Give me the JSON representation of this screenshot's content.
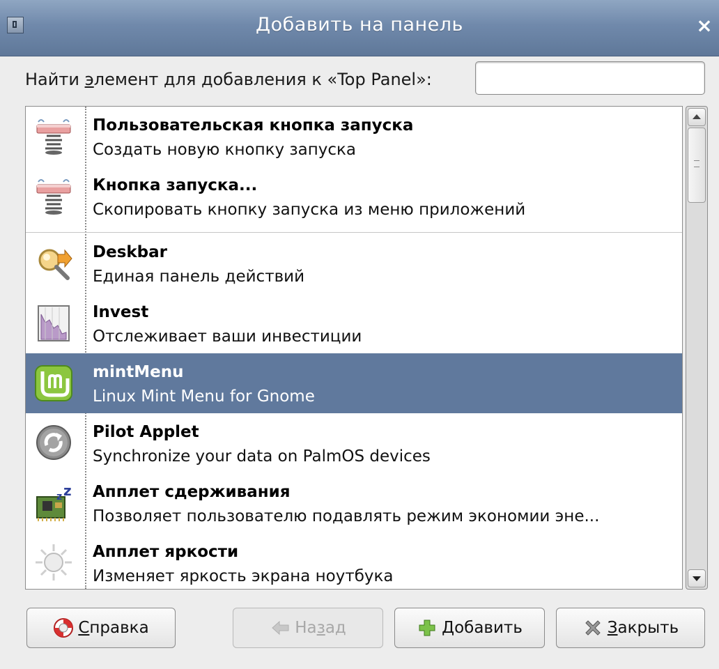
{
  "window": {
    "title": "Добавить на панель",
    "close_glyph": "×"
  },
  "search": {
    "label_before": "Найти ",
    "label_mnemonic": "э",
    "label_after": "лемент для добавления к «Top Panel»:",
    "value": "",
    "placeholder": ""
  },
  "items": [
    {
      "name": "Пользовательская кнопка запуска",
      "description": "Создать новую кнопку запуска",
      "icon": "launcher-spring-icon",
      "selected": false
    },
    {
      "name": "Кнопка запуска...",
      "description": "Скопировать кнопку запуска из меню приложений",
      "icon": "launcher-spring-icon",
      "selected": false
    },
    {
      "name": "Deskbar",
      "description": "Единая панель действий",
      "icon": "magnifier-arrow-icon",
      "selected": false
    },
    {
      "name": "Invest",
      "description": "Отслеживает ваши инвестиции",
      "icon": "stock-chart-icon",
      "selected": false
    },
    {
      "name": "mintMenu",
      "description": "Linux Mint Menu for Gnome",
      "icon": "linux-mint-logo-icon",
      "selected": true
    },
    {
      "name": "Pilot Applet",
      "description": "Synchronize your data on PalmOS devices",
      "icon": "sync-circle-icon",
      "selected": false
    },
    {
      "name": "Апплет сдерживания",
      "description": "Позволяет пользователю подавлять режим экономии эне...",
      "icon": "sleep-chip-icon",
      "selected": false
    },
    {
      "name": "Апплет яркости",
      "description": "Изменяет яркость экрана ноутбука",
      "icon": "brightness-sun-icon",
      "selected": false
    }
  ],
  "buttons": {
    "help": {
      "mnemonic": "С",
      "rest": "правка",
      "icon": "lifebuoy-icon"
    },
    "back": {
      "before": "На",
      "mnemonic": "з",
      "rest": "ад",
      "icon": "back-arrow-icon",
      "enabled": false
    },
    "add": {
      "mnemonic": "Д",
      "rest": "обавить",
      "icon": "plus-icon"
    },
    "close": {
      "mnemonic": "З",
      "rest": "акрыть",
      "icon": "close-x-icon"
    }
  },
  "colors": {
    "titlebar": "#7089ab",
    "selection": "#60799d",
    "window_bg": "#ededed"
  }
}
